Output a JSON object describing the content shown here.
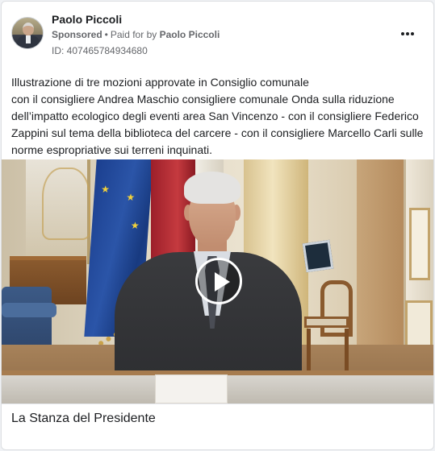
{
  "post": {
    "author": "Paolo Piccoli",
    "sponsored": "Sponsored",
    "separator": "•",
    "paid_for_prefix": "Paid for by",
    "paid_for_name": "Paolo Piccoli",
    "ad_id": "ID: 407465784934680",
    "more_icon": "more-horizontal-icon",
    "body_lines": [
      "Illustrazione di tre mozioni approvate in Consiglio comunale",
      "con il consigliere Andrea Maschio consigliere comunale Onda sulla riduzione",
      "dell’impatto ecologico degli eventi area San Vincenzo - con il consigliere Federico",
      "Zappini sul tema della biblioteca del carcere - con il consigliere Marcello Carli sulle",
      "norme espropriative sui terreni inquinati."
    ]
  },
  "video": {
    "play_icon": "play-icon",
    "caption": "La Stanza del Presidente"
  },
  "colors": {
    "text_primary": "#1c1e21",
    "text_secondary": "#65676b",
    "card_border": "#dddfe2",
    "background": "#f0f2f5"
  }
}
